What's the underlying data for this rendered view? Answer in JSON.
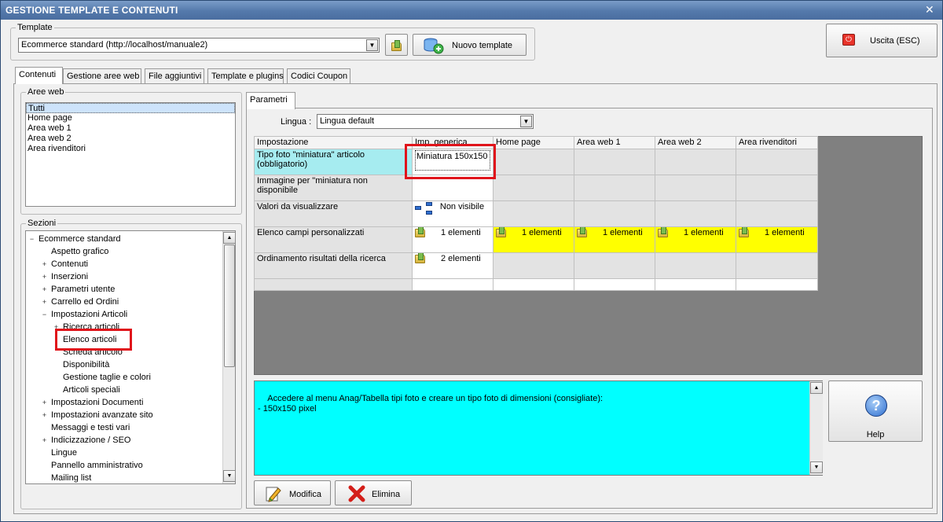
{
  "window": {
    "title": "GESTIONE TEMPLATE E CONTENUTI",
    "close_glyph": "✕"
  },
  "template_group": {
    "legend": "Template",
    "selected": "Ecommerce standard (http://localhost/manuale2)",
    "new_button": "Nuovo template"
  },
  "exit_button": "Uscita (ESC)",
  "tabs": [
    "Contenuti",
    "Gestione aree web",
    "File aggiuntivi",
    "Template e plugins",
    "Codici Coupon"
  ],
  "aree_web": {
    "legend": "Aree web",
    "items": [
      "Tutti",
      "Home page",
      "Area web 1",
      "Area web 2",
      "Area rivenditori"
    ]
  },
  "sezioni": {
    "legend": "Sezioni",
    "tree": [
      {
        "label": "Ecommerce standard",
        "toggle": "−",
        "level": 0
      },
      {
        "label": "Aspetto grafico",
        "toggle": "",
        "level": 1
      },
      {
        "label": "Contenuti",
        "toggle": "+",
        "level": 1
      },
      {
        "label": "Inserzioni",
        "toggle": "+",
        "level": 1
      },
      {
        "label": "Parametri utente",
        "toggle": "+",
        "level": 1
      },
      {
        "label": "Carrello ed Ordini",
        "toggle": "+",
        "level": 1
      },
      {
        "label": "Impostazioni Articoli",
        "toggle": "−",
        "level": 1
      },
      {
        "label": "Ricerca articoli",
        "toggle": "+",
        "level": 2
      },
      {
        "label": "Elenco articoli",
        "toggle": "",
        "level": 2
      },
      {
        "label": "Scheda articolo",
        "toggle": "",
        "level": 2
      },
      {
        "label": "Disponibilità",
        "toggle": "",
        "level": 2
      },
      {
        "label": "Gestione taglie e colori",
        "toggle": "",
        "level": 2
      },
      {
        "label": "Articoli speciali",
        "toggle": "",
        "level": 2
      },
      {
        "label": "Impostazioni Documenti",
        "toggle": "+",
        "level": 1
      },
      {
        "label": "Impostazioni avanzate sito",
        "toggle": "+",
        "level": 1
      },
      {
        "label": "Messaggi e testi vari",
        "toggle": "",
        "level": 1
      },
      {
        "label": "Indicizzazione / SEO",
        "toggle": "+",
        "level": 1
      },
      {
        "label": "Lingue",
        "toggle": "",
        "level": 1
      },
      {
        "label": "Pannello amministrativo",
        "toggle": "",
        "level": 1
      },
      {
        "label": "Mailing list",
        "toggle": "",
        "level": 1
      }
    ]
  },
  "parametri": {
    "tab": "Parametri",
    "lingua_label": "Lingua :",
    "lingua_value": "Lingua default",
    "columns": [
      "Impostazione",
      "Imp. generica",
      "Home page",
      "Area web 1",
      "Area web 2",
      "Area rivenditori"
    ],
    "rows": [
      {
        "label": "Tipo foto \"miniatura\" articolo (obbligatorio)",
        "generic": "Miniatura 150x150",
        "others": [
          "",
          "",
          "",
          ""
        ]
      },
      {
        "label": "Immagine per \"miniatura non disponibile",
        "generic": "",
        "others": [
          "",
          "",
          "",
          ""
        ]
      },
      {
        "label": "Valori da visualizzare",
        "generic": "Non visibile",
        "others": [
          "",
          "",
          "",
          ""
        ]
      },
      {
        "label": "Elenco campi personalizzati",
        "generic": "1 elementi",
        "others": [
          "1 elementi",
          "1 elementi",
          "1 elementi",
          "1 elementi"
        ]
      },
      {
        "label": "Ordinamento risultati della ricerca",
        "generic": "2 elementi",
        "others": [
          "",
          "",
          "",
          ""
        ]
      }
    ],
    "description": "Accedere al menu Anag/Tabella tipi foto e creare un tipo foto di dimensioni (consigliate):\n- 150x150 pixel",
    "help_button": "Help",
    "modifica_button": "Modifica",
    "elimina_button": "Elimina"
  },
  "colors": {
    "highlight": "#e0141b",
    "description_bg": "#00ffff",
    "row_bg": "#ffff00"
  }
}
